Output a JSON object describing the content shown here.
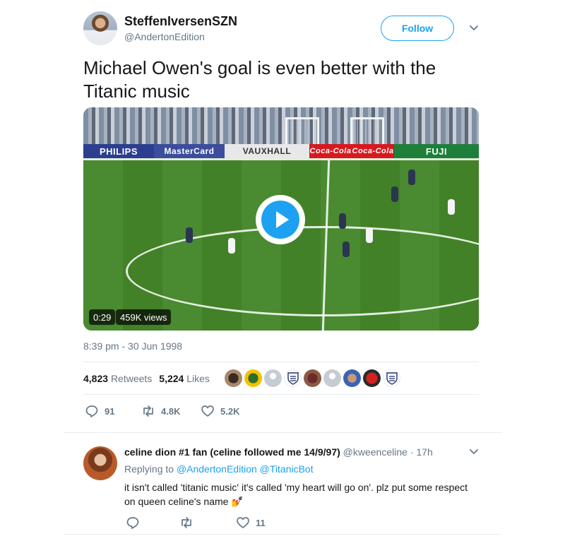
{
  "tweet": {
    "display_name": "SteffenIversenSZN",
    "handle": "@AndertonEdition",
    "follow_label": "Follow",
    "text": "Michael Owen's goal is even better with the Titanic music",
    "video": {
      "duration": "0:29",
      "views": "459K views",
      "ads": [
        "PHILIPS",
        "MasterCard",
        "VAUXHALL",
        "Coca-Cola",
        "Coca-Cola",
        "FUJI"
      ]
    },
    "timestamp": "8:39 pm - 30 Jun 1998",
    "stats": {
      "retweets_count": "4,823",
      "retweets_label": "Retweets",
      "likes_count": "5,224",
      "likes_label": "Likes"
    },
    "actions": {
      "replies": "91",
      "retweets": "4.8K",
      "likes": "5.2K"
    }
  },
  "reply": {
    "display_name": "celine dion #1 fan (celine followed me 14/9/97)",
    "handle": "@kweenceline",
    "separator": "·",
    "time": "17h",
    "replying_prefix": "Replying to",
    "replying_to_1": "@AndertonEdition",
    "replying_to_2": "@TitanicBot",
    "text": "it isn't called 'titanic music' it's called 'my heart will go on'. plz put some respect on queen celine's name 💅",
    "likes": "11"
  },
  "colors": {
    "accent": "#1da1f2",
    "text": "#14171a",
    "muted": "#657786",
    "divider": "#e6ecf0"
  }
}
